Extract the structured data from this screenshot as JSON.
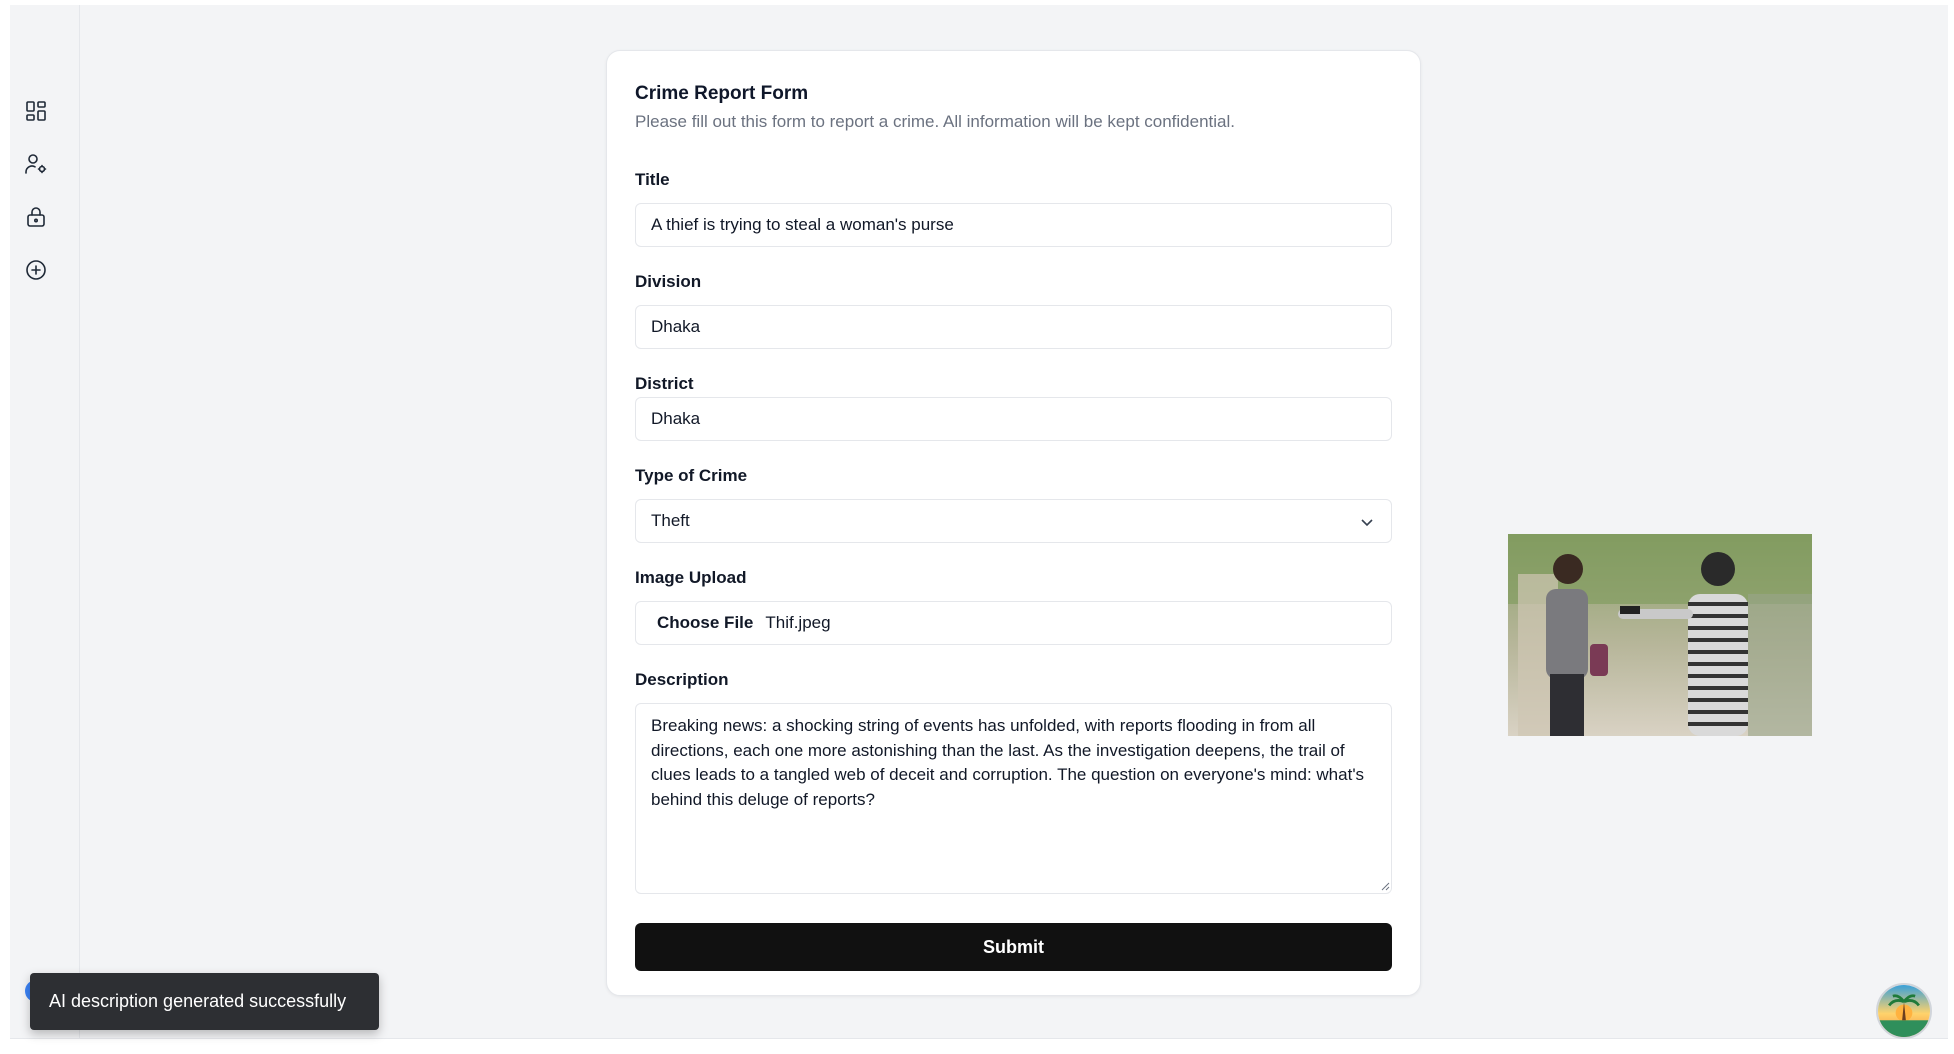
{
  "sidebar": {
    "icons": [
      "dashboard-icon",
      "user-settings-icon",
      "lock-icon",
      "add-circle-icon"
    ]
  },
  "form": {
    "title": "Crime Report Form",
    "subtitle": "Please fill out this form to report a crime. All information will be kept confidential.",
    "fields": {
      "title": {
        "label": "Title",
        "value": "A thief is trying to steal a woman's purse"
      },
      "division": {
        "label": "Division",
        "value": "Dhaka"
      },
      "district": {
        "label": "District",
        "value": "Dhaka"
      },
      "crime_type": {
        "label": "Type of Crime",
        "value": "Theft"
      },
      "image_upload": {
        "label": "Image Upload",
        "button": "Choose File",
        "file_name": "Thif.jpeg"
      },
      "description": {
        "label": "Description",
        "value": "Breaking news: a shocking string of events has unfolded, with reports flooding in from all directions, each one more astonishing than the last. As the investigation deepens, the trail of clues leads to a tangled web of deceit and corruption. The question on everyone's mind: what's behind this deluge of reports?"
      }
    },
    "submit_label": "Submit"
  },
  "toast": {
    "message": "AI description generated successfully"
  },
  "colors": {
    "background": "#f3f4f6",
    "card": "#ffffff",
    "submit": "#111111",
    "toast": "#2d2f33"
  }
}
